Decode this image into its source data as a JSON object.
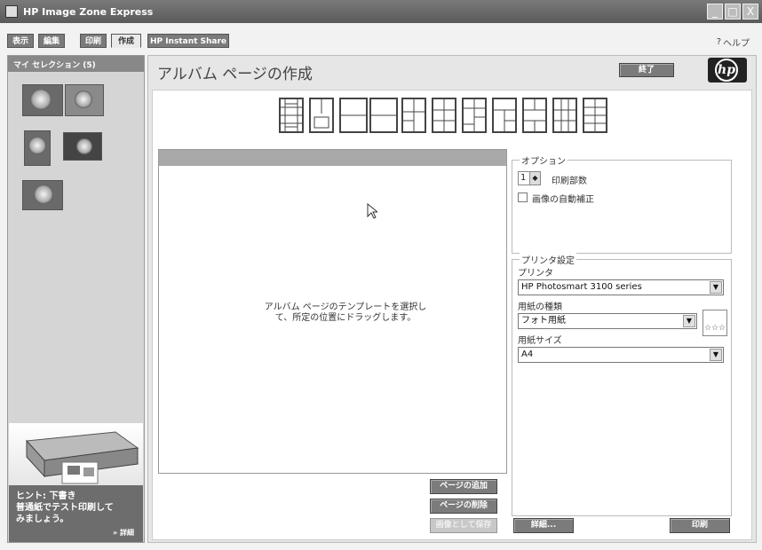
{
  "window": {
    "title": "HP Image Zone Express",
    "min_label": "_",
    "max_label": "□",
    "close_label": "X"
  },
  "tabs": [
    {
      "label": "表示"
    },
    {
      "label": "編集"
    },
    {
      "label": "印刷"
    },
    {
      "label": "作成"
    },
    {
      "label": "HP Instant Share"
    }
  ],
  "help": {
    "label": "ヘルプ"
  },
  "sidebar": {
    "header": "マイ セレクション (5)",
    "tip_line1": "ヒント: 下書き",
    "tip_line2": "普通紙でテスト印刷して",
    "tip_line3": "みましょう。",
    "tip_more": "» 詳細"
  },
  "main": {
    "title": "アルバム ページの作成",
    "finish_label": "終了",
    "hp_logo_text": "hp",
    "canvas_message": "アルバム ページのテンプレートを選択して、所定の位置にドラッグします。",
    "add_page_label": "ページの追加",
    "delete_page_label": "ページの削除",
    "save_as_image_label": "画像として保存",
    "details_label": "詳細...",
    "print_label": "印刷"
  },
  "options": {
    "legend": "オプション",
    "copies_value": "1",
    "copies_label": "印刷部数",
    "auto_fix_label": "画像の自動補正"
  },
  "printer_settings": {
    "legend": "プリンタ設定",
    "printer_label": "プリンタ",
    "printer_value": "HP Photosmart 3100 series",
    "paper_type_label": "用紙の種類",
    "paper_type_value": "フォト用紙",
    "paper_size_label": "用紙サイズ",
    "paper_size_value": "A4",
    "quality_stars": "☆☆☆"
  }
}
